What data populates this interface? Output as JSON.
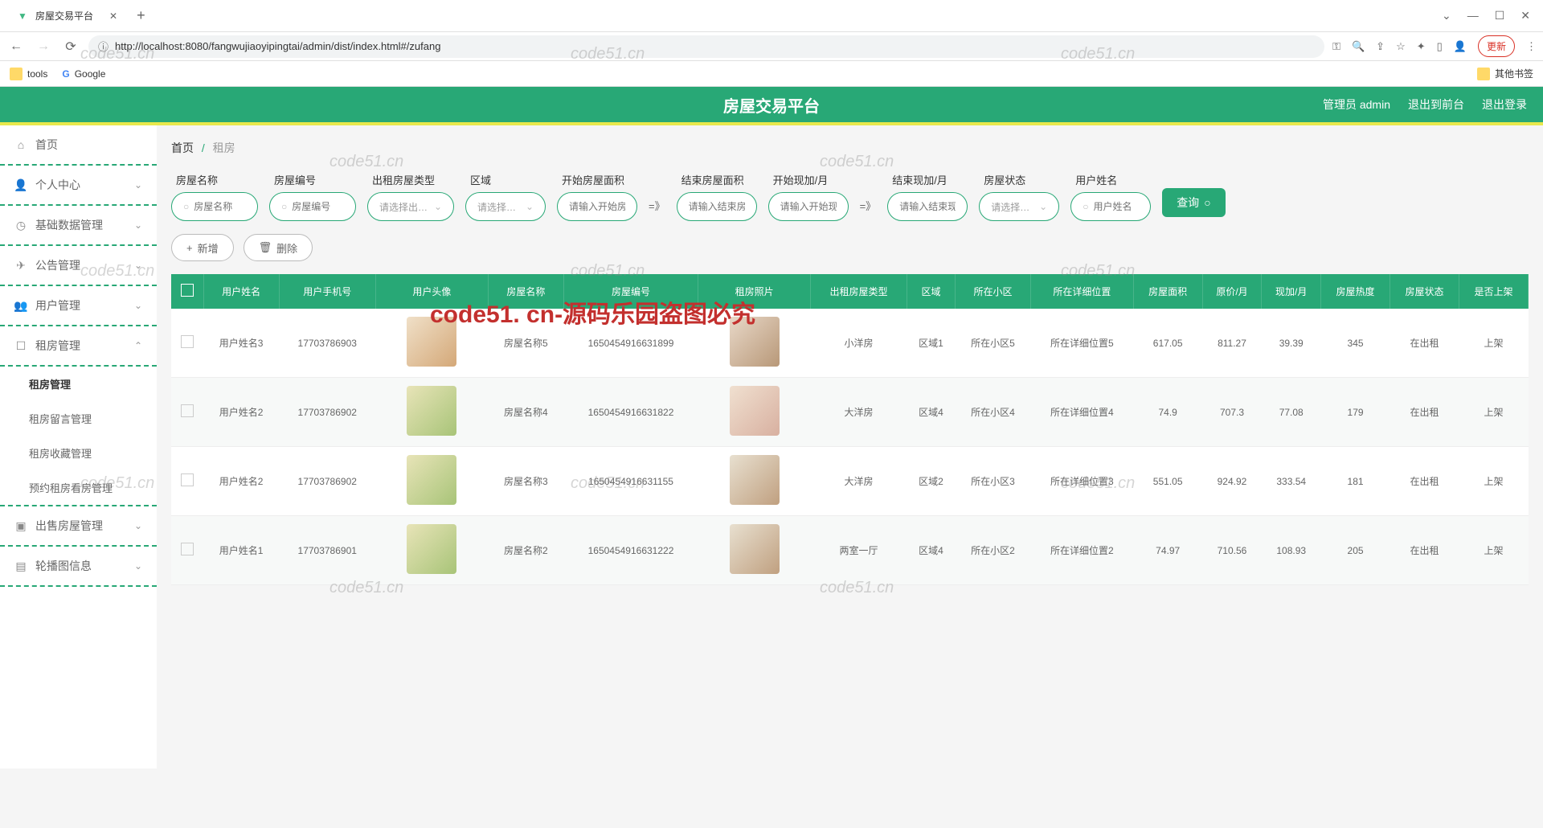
{
  "browser": {
    "tab_title": "房屋交易平台",
    "url": "http://localhost:8080/fangwujiaoyipingtai/admin/dist/index.html#/zufang",
    "update_label": "更新",
    "bookmarks": {
      "tools": "tools",
      "google": "Google",
      "other": "其他书签"
    }
  },
  "header": {
    "title": "房屋交易平台",
    "admin_label": "管理员 admin",
    "exit_front": "退出到前台",
    "exit_login": "退出登录"
  },
  "sidebar": {
    "home": "首页",
    "personal_center": "个人中心",
    "basic_data": "基础数据管理",
    "notice": "公告管理",
    "user_mgmt": "用户管理",
    "rent_mgmt": "租房管理",
    "rent_sub1": "租房管理",
    "rent_sub2": "租房留言管理",
    "rent_sub3": "租房收藏管理",
    "rent_sub4": "预约租房看房管理",
    "sale_mgmt": "出售房屋管理",
    "carousel": "轮播图信息"
  },
  "breadcrumb": {
    "home": "首页",
    "current": "租房"
  },
  "filters": {
    "house_name": {
      "label": "房屋名称",
      "placeholder": "房屋名称"
    },
    "house_no": {
      "label": "房屋编号",
      "placeholder": "房屋编号"
    },
    "rent_type": {
      "label": "出租房屋类型",
      "placeholder": "请选择出租房屋类型"
    },
    "region": {
      "label": "区域",
      "placeholder": "请选择区域"
    },
    "start_area": {
      "label": "开始房屋面积",
      "placeholder": "请输入开始房屋面积"
    },
    "end_area": {
      "label": "结束房屋面积",
      "placeholder": "请输入结束房屋面积"
    },
    "start_price": {
      "label": "开始现加/月",
      "placeholder": "请输入开始现加"
    },
    "end_price": {
      "label": "结束现加/月",
      "placeholder": "请输入结束现加"
    },
    "house_status": {
      "label": "房屋状态",
      "placeholder": "请选择房屋状态"
    },
    "user_name": {
      "label": "用户姓名",
      "placeholder": "用户姓名"
    },
    "between": "=》",
    "query": "查询"
  },
  "actions": {
    "add": "新增",
    "delete": "删除"
  },
  "table": {
    "headers": [
      "用户姓名",
      "用户手机号",
      "用户头像",
      "房屋名称",
      "房屋编号",
      "租房照片",
      "出租房屋类型",
      "区域",
      "所在小区",
      "所在详细位置",
      "房屋面积",
      "原价/月",
      "现加/月",
      "房屋热度",
      "房屋状态",
      "是否上架"
    ],
    "rows": [
      {
        "name": "用户姓名3",
        "phone": "17703786903",
        "house_name": "房屋名称5",
        "house_no": "1650454916631899",
        "type": "小洋房",
        "region": "区域1",
        "community": "所在小区5",
        "location": "所在详细位置5",
        "area": "617.05",
        "orig_price": "811.27",
        "cur_price": "39.39",
        "heat": "345",
        "status": "在出租",
        "shelf": "上架"
      },
      {
        "name": "用户姓名2",
        "phone": "17703786902",
        "house_name": "房屋名称4",
        "house_no": "1650454916631822",
        "type": "大洋房",
        "region": "区域4",
        "community": "所在小区4",
        "location": "所在详细位置4",
        "area": "74.9",
        "orig_price": "707.3",
        "cur_price": "77.08",
        "heat": "179",
        "status": "在出租",
        "shelf": "上架"
      },
      {
        "name": "用户姓名2",
        "phone": "17703786902",
        "house_name": "房屋名称3",
        "house_no": "1650454916631155",
        "type": "大洋房",
        "region": "区域2",
        "community": "所在小区3",
        "location": "所在详细位置3",
        "area": "551.05",
        "orig_price": "924.92",
        "cur_price": "333.54",
        "heat": "181",
        "status": "在出租",
        "shelf": "上架"
      },
      {
        "name": "用户姓名1",
        "phone": "17703786901",
        "house_name": "房屋名称2",
        "house_no": "1650454916631222",
        "type": "两室一厅",
        "region": "区域4",
        "community": "所在小区2",
        "location": "所在详细位置2",
        "area": "74.97",
        "orig_price": "710.56",
        "cur_price": "108.93",
        "heat": "205",
        "status": "在出租",
        "shelf": "上架"
      }
    ]
  },
  "watermark": {
    "text": "code51.cn",
    "red": "code51. cn-源码乐园盗图必究"
  }
}
